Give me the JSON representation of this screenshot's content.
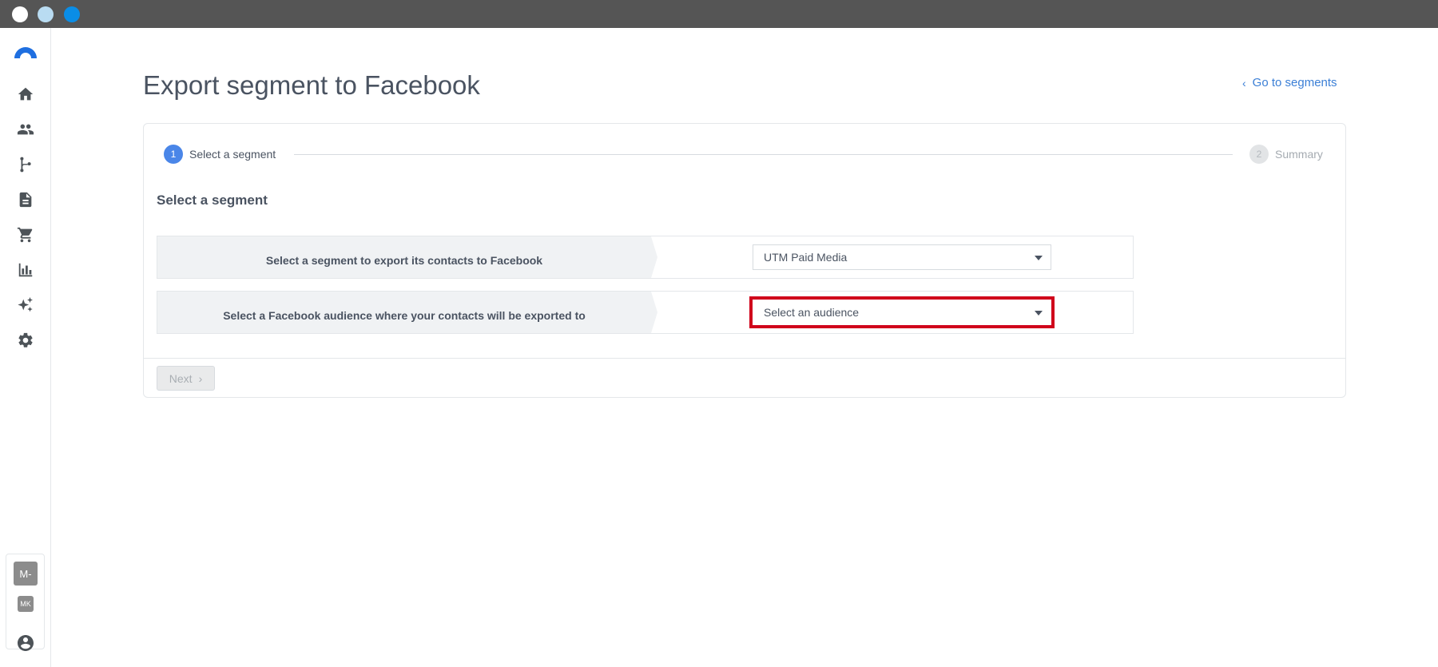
{
  "window": {
    "controls": [
      "close",
      "minimize",
      "maximize"
    ]
  },
  "sidebar": {
    "logo": "brand-logo",
    "items": [
      {
        "name": "home",
        "icon": "home-icon"
      },
      {
        "name": "contacts",
        "icon": "people-icon"
      },
      {
        "name": "automation",
        "icon": "branch-icon"
      },
      {
        "name": "templates",
        "icon": "document-icon"
      },
      {
        "name": "ecommerce",
        "icon": "cart-icon"
      },
      {
        "name": "reports",
        "icon": "bar-chart-icon"
      },
      {
        "name": "ai",
        "icon": "sparkle-icon"
      },
      {
        "name": "settings",
        "icon": "gear-icon"
      }
    ],
    "account": {
      "primary": "M-",
      "secondary": "MK"
    },
    "user_icon": "user-circle-icon"
  },
  "header": {
    "title": "Export segment to Facebook",
    "back_link": "Go to segments"
  },
  "stepper": {
    "steps": [
      {
        "number": "1",
        "label": "Select a segment",
        "active": true
      },
      {
        "number": "2",
        "label": "Summary",
        "active": false
      }
    ]
  },
  "main": {
    "section_title": "Select a segment",
    "rows": [
      {
        "label": "Select a segment to export its contacts to Facebook",
        "select_value": "UTM Paid Media"
      },
      {
        "label": "Select a Facebook audience where your contacts will be exported to",
        "select_value": "Select an audience"
      }
    ],
    "next_button": "Next"
  },
  "colors": {
    "accent": "#4a86e8",
    "link": "#3b7fd6",
    "highlight": "#d0021b",
    "titlebar": "#555555"
  }
}
